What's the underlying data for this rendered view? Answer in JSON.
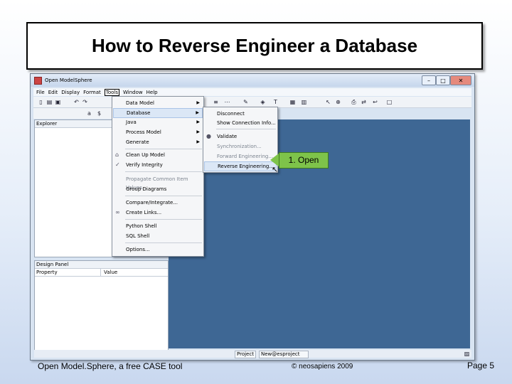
{
  "slide": {
    "title": "How to Reverse Engineer a Database",
    "footer_left": "Open Model.Sphere, a free CASE tool",
    "footer_center": "© neosapiens 2009",
    "page_label": "Page 5"
  },
  "window": {
    "title": "Open ModelSphere",
    "minimize": "–",
    "maximize": "□",
    "close": "✕"
  },
  "menubar": [
    "File",
    "Edit",
    "Display",
    "Format",
    "Tools",
    "Window",
    "Help"
  ],
  "panels": {
    "explorer": "Explorer",
    "design_panel": "Design Panel",
    "property_col": "Property",
    "value_col": "Value"
  },
  "statusbar": {
    "project": "Project",
    "project_name": "New@esproject"
  },
  "tools_menu": [
    {
      "label": "Data Model",
      "submenu": true
    },
    {
      "label": "Database",
      "submenu": true
    },
    {
      "label": "Java",
      "submenu": true
    },
    {
      "label": "Process Model",
      "submenu": true
    },
    {
      "label": "Generate",
      "submenu": true
    },
    {
      "label": "Clean Up Model"
    },
    {
      "label": "Verify Integrity"
    },
    {
      "label": "Propagate Common Item Values...",
      "disabled": true
    },
    {
      "label": "Group Diagrams"
    },
    {
      "label": "Compare/Integrate..."
    },
    {
      "label": "Create Links..."
    },
    {
      "label": "Python Shell"
    },
    {
      "label": "SQL Shell"
    },
    {
      "label": "Options..."
    }
  ],
  "database_menu": [
    {
      "label": "Disconnect"
    },
    {
      "label": "Show Connection Info..."
    },
    {
      "label": "Validate"
    },
    {
      "label": "Synchronization...",
      "disabled": true
    },
    {
      "label": "Forward Engineering...",
      "disabled": true
    },
    {
      "label": "Reverse Engineering..."
    }
  ],
  "callout": {
    "text": "1. Open"
  },
  "colors": {
    "canvas": "#3e6794",
    "callout": "#7ec34a"
  }
}
